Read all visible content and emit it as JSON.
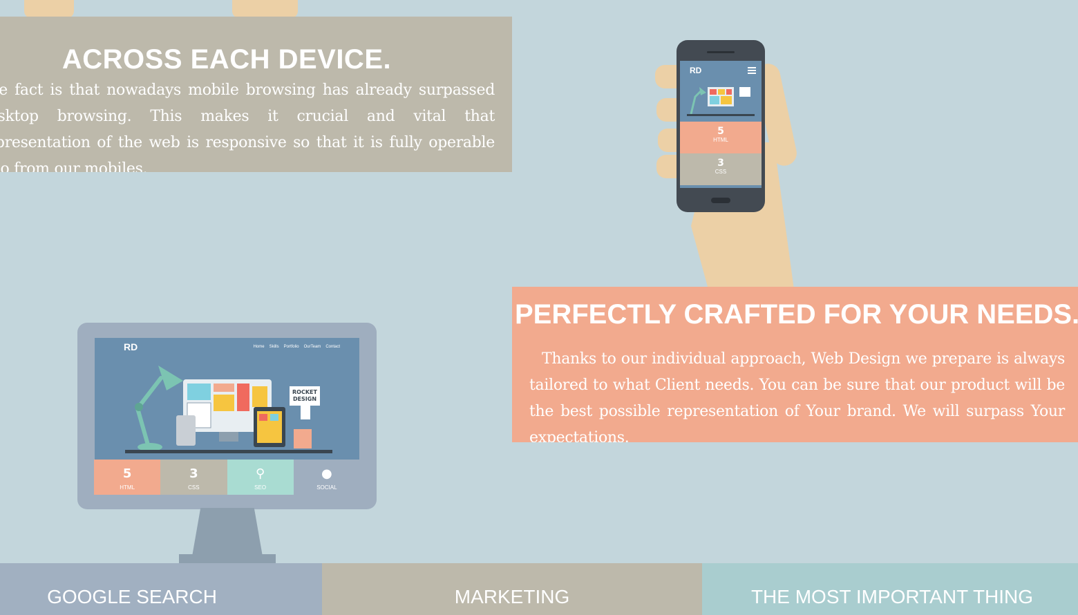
{
  "colors": {
    "background": "#c3d6dc",
    "panel_beige": "#bdb9ab",
    "panel_salmon": "#f2aa8e",
    "tab_blue": "#a1b0c1",
    "tab_teal": "#a9cdcf",
    "skin": "#ecd0a6"
  },
  "device_panel": {
    "title": "ACROSS EACH DEVICE.",
    "text": "The fact is that nowadays mobile browsing has already surpassed desktop browsing. This makes it crucial and vital that representation of the web is responsive so that it is fully operable also from our mobiles."
  },
  "crafted_panel": {
    "title": "PERFECTLY CRAFTED FOR YOUR NEEDS.",
    "text": "Thanks to our individual approach, Web Design we prepare is always tailored to what Client needs. You can be sure that our product will be the best possible representation of Your brand. We will surpass Your expectations."
  },
  "phone": {
    "logo": "RD",
    "tiles": [
      {
        "icon": "html5-icon",
        "glyph": "5",
        "label": "HTML",
        "color": "#f2aa8e"
      },
      {
        "icon": "css3-icon",
        "glyph": "3",
        "label": "CSS",
        "color": "#bdb9ab"
      }
    ]
  },
  "monitor": {
    "logo": "RD",
    "nav": [
      "Home",
      "Skills",
      "Portfolio",
      "OurTeam",
      "Contact"
    ],
    "badge": "ROCKET DESIGN",
    "tiles": [
      {
        "icon": "html5-icon",
        "glyph": "5",
        "label": "HTML",
        "color": "#f2aa8e"
      },
      {
        "icon": "css3-icon",
        "glyph": "3",
        "label": "CSS",
        "color": "#bdb9ab"
      },
      {
        "icon": "search-icon",
        "glyph": "⚲",
        "label": "SEO",
        "color": "#a9dcd2"
      },
      {
        "icon": "people-icon",
        "glyph": "●",
        "label": "SOCIAL",
        "color": "#9faebf"
      }
    ]
  },
  "tabs": {
    "google": "GOOGLE SEARCH",
    "marketing": "MARKETING",
    "important": "THE MOST IMPORTANT THING"
  }
}
